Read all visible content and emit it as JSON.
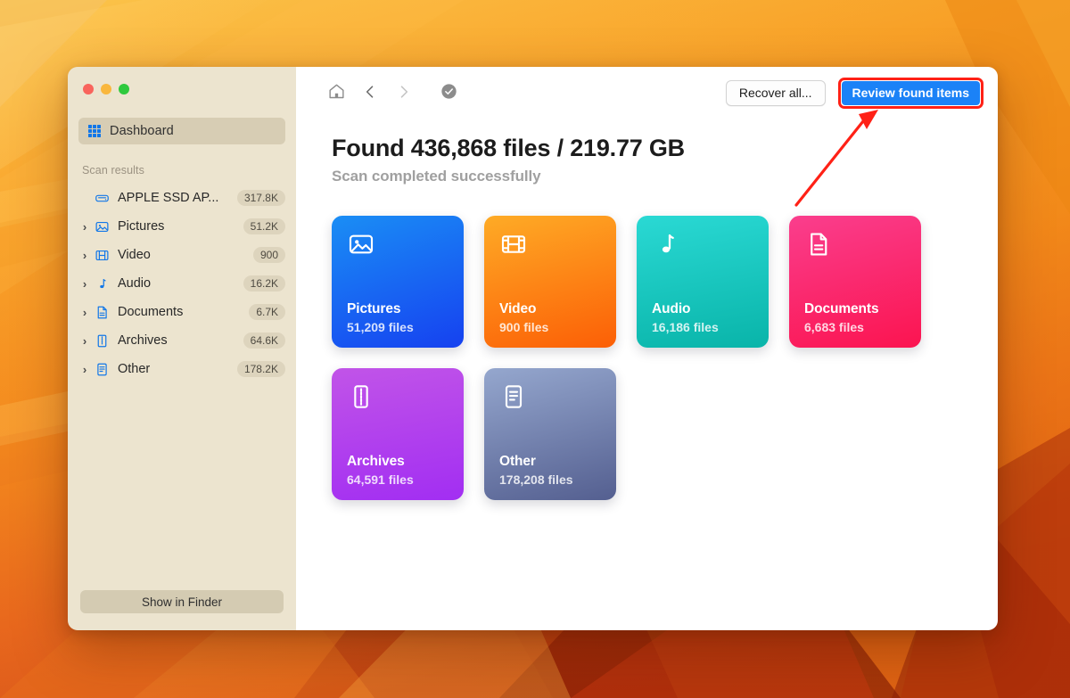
{
  "window": {
    "traffic_lights": [
      "close",
      "minimize",
      "zoom"
    ]
  },
  "sidebar": {
    "dashboard": {
      "label": "Dashboard",
      "icon": "grid-icon",
      "selected": true
    },
    "section_title": "Scan results",
    "items": [
      {
        "label": "APPLE SSD AP...",
        "badge": "317.8K",
        "icon": "disk-icon",
        "expandable": false
      },
      {
        "label": "Pictures",
        "badge": "51.2K",
        "icon": "photo-icon",
        "expandable": true
      },
      {
        "label": "Video",
        "badge": "900",
        "icon": "film-icon",
        "expandable": true
      },
      {
        "label": "Audio",
        "badge": "16.2K",
        "icon": "music-note-icon",
        "expandable": true
      },
      {
        "label": "Documents",
        "badge": "6.7K",
        "icon": "document-icon",
        "expandable": true
      },
      {
        "label": "Archives",
        "badge": "64.6K",
        "icon": "zip-icon",
        "expandable": true
      },
      {
        "label": "Other",
        "badge": "178.2K",
        "icon": "list-doc-icon",
        "expandable": true
      }
    ],
    "show_in_finder": "Show in Finder"
  },
  "toolbar": {
    "home_icon": "home-icon",
    "back_icon": "chevron-left-icon",
    "forward_icon": "chevron-right-icon",
    "status_icon": "check-circle-icon",
    "recover_all": "Recover all...",
    "review_found_items": "Review found items",
    "primary_color": "#1b82f7",
    "highlight_color": "#ff2116"
  },
  "main": {
    "title": "Found 436,868 files / 219.77 GB",
    "subtitle": "Scan completed successfully",
    "total_files": "436,868",
    "total_size": "219.77 GB"
  },
  "cards": [
    {
      "title": "Pictures",
      "count": "51,209 files",
      "icon": "photo-icon",
      "color_from": "#1a8ef5",
      "color_to": "#1641f0"
    },
    {
      "title": "Video",
      "count": "900 files",
      "icon": "film-icon",
      "color_from": "#feab26",
      "color_to": "#fc5f06"
    },
    {
      "title": "Audio",
      "count": "16,186 files",
      "icon": "music-note-icon",
      "color_from": "#28d7d7",
      "color_to": "#0bb7ab"
    },
    {
      "title": "Documents",
      "count": "6,683 files",
      "icon": "document-icon",
      "color_from": "#fa3e8d",
      "color_to": "#fb1450"
    },
    {
      "title": "Archives",
      "count": "64,591 files",
      "icon": "zip-icon",
      "color_from": "#c154e8",
      "color_to": "#a22ef2"
    },
    {
      "title": "Other",
      "count": "178,208 files",
      "icon": "list-doc-icon",
      "color_from": "#8fa3cb",
      "color_to": "#5a6595"
    }
  ],
  "annotation": {
    "type": "arrow",
    "color": "#ff2116",
    "points_to": "review_found_items"
  }
}
